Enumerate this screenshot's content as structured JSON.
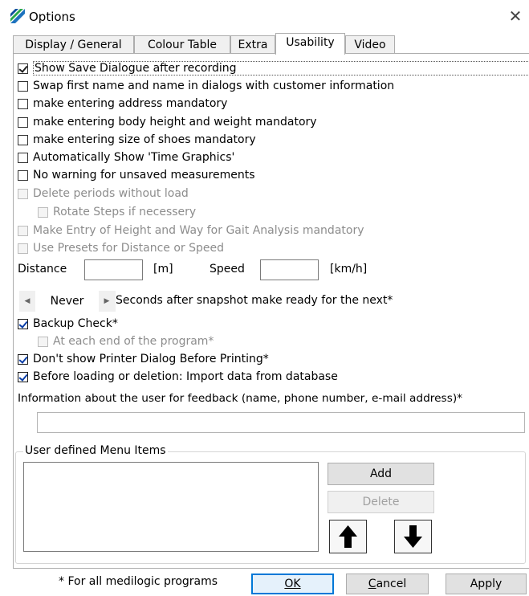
{
  "window": {
    "title": "Options",
    "close_icon": "close-icon",
    "app_icon": "app-logo-icon"
  },
  "tabs": [
    {
      "label": "Display / General",
      "active": false
    },
    {
      "label": "Colour Table",
      "active": false
    },
    {
      "label": "Extra",
      "active": false
    },
    {
      "label": "Usability",
      "active": true
    },
    {
      "label": "Video",
      "active": false
    }
  ],
  "checkboxes": {
    "show_save_dialogue": {
      "label": "Show Save Dialogue after recording",
      "checked": true
    },
    "swap_names": {
      "label": "Swap first name and name in dialogs with customer information",
      "checked": false
    },
    "address_mandatory": {
      "label": "make entering address mandatory",
      "checked": false
    },
    "body_mandatory": {
      "label": "make entering body height and weight mandatory",
      "checked": false
    },
    "shoes_mandatory": {
      "label": "make entering size of shoes mandatory",
      "checked": false
    },
    "time_graphics": {
      "label": "Automatically Show 'Time Graphics'",
      "checked": false
    },
    "no_warning": {
      "label": "No warning for unsaved measurements",
      "checked": false
    },
    "delete_periods": {
      "label": "Delete periods without load",
      "checked": false,
      "disabled": true
    },
    "rotate_steps": {
      "label": "Rotate Steps if necessery",
      "checked": false,
      "disabled": true
    },
    "gait_mandatory": {
      "label": "Make Entry of Height and Way for Gait Analysis mandatory",
      "checked": false,
      "disabled": true
    },
    "use_presets": {
      "label": "Use Presets for Distance or Speed",
      "checked": false,
      "disabled": true
    },
    "backup_check": {
      "label": "Backup Check*",
      "checked": true
    },
    "each_end": {
      "label": "At each end of the program*",
      "checked": false,
      "disabled": true
    },
    "no_printer_dialog": {
      "label": "Don't show Printer Dialog Before Printing*",
      "checked": true
    },
    "import_data": {
      "label": "Before loading or deletion: Import data from database",
      "checked": true
    }
  },
  "presets": {
    "distance_label": "Distance",
    "distance_value": "",
    "distance_unit": "[m]",
    "speed_label": "Speed",
    "speed_value": "",
    "speed_unit": "[km/h]"
  },
  "snapshot": {
    "value": "Never",
    "label": "Seconds after snapshot make ready for the next*"
  },
  "feedback": {
    "label": "Information about the user for feedback (name, phone number, e-mail address)*",
    "value": ""
  },
  "menu_items": {
    "legend": "User defined Menu Items",
    "items": [],
    "add_label": "Add",
    "delete_label": "Delete",
    "up_icon": "arrow-up-icon",
    "down_icon": "arrow-down-icon"
  },
  "footer": {
    "note": "* For all medilogic programs",
    "ok_label": "OK",
    "cancel_label": "Cancel",
    "apply_label": "Apply"
  }
}
